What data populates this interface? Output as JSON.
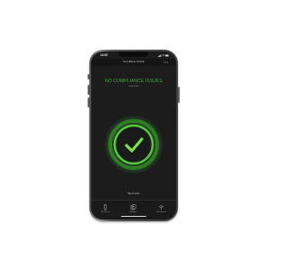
{
  "device": {
    "status_bar": {
      "time": "14:03"
    },
    "app_bar": {
      "title": "SecuBlade Mobile"
    },
    "compliance": {
      "headline": "NO COMPLIANCE ISSUES",
      "subtext": "Last scan",
      "status": "compliant",
      "check_icon": "check-icon"
    },
    "scan": {
      "hint": "Tap to scan"
    },
    "tabs": [
      {
        "label": "My Device",
        "icon": "phone-icon"
      },
      {
        "label": "My Apps",
        "icon": "apps-icon"
      },
      {
        "label": "My Network",
        "icon": "wifi-icon"
      }
    ]
  },
  "colors": {
    "accent_green": "#3cb038",
    "ring_green": "#2e7d24",
    "screen_bg": "#1c1c1d",
    "frame": "#5a5a5a"
  }
}
